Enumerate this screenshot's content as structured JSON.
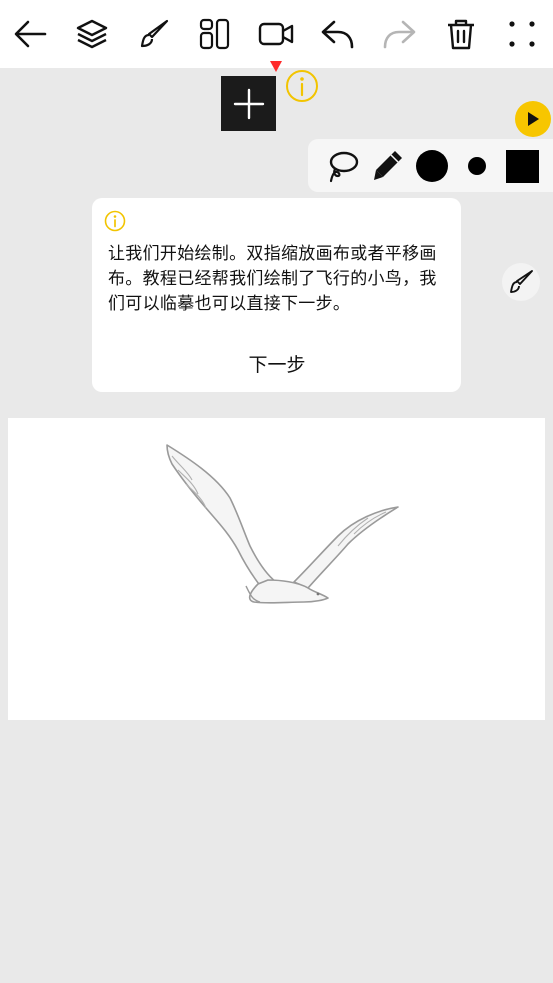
{
  "toolbar": {
    "icons": [
      "back-arrow-icon",
      "layers-icon",
      "brush-icon",
      "layout-icon",
      "video-icon",
      "undo-icon",
      "redo-icon",
      "trash-icon",
      "more-icon"
    ]
  },
  "tools": {
    "icons": [
      "lasso-icon",
      "pencil-icon",
      "large-dot-icon",
      "small-dot-icon",
      "color-square-icon"
    ],
    "current_color": "#000000"
  },
  "tutorial": {
    "message": "让我们开始绘制。双指缩放画布或者平移画布。教程已经帮我们绘制了飞行的小鸟，我们可以临摹也可以直接下一步。",
    "next_label": "下一步"
  },
  "colors": {
    "accent": "#f7c600",
    "marker": "#ff2a2a"
  }
}
